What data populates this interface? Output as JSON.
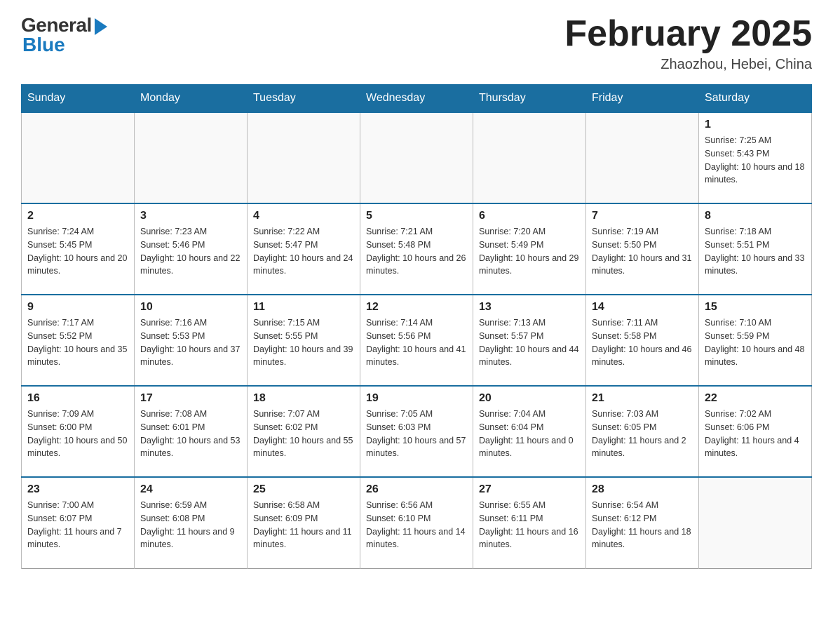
{
  "header": {
    "logo_general": "General",
    "logo_blue": "Blue",
    "month_title": "February 2025",
    "location": "Zhaozhou, Hebei, China"
  },
  "weekdays": [
    "Sunday",
    "Monday",
    "Tuesday",
    "Wednesday",
    "Thursday",
    "Friday",
    "Saturday"
  ],
  "weeks": [
    {
      "days": [
        {
          "num": "",
          "empty": true
        },
        {
          "num": "",
          "empty": true
        },
        {
          "num": "",
          "empty": true
        },
        {
          "num": "",
          "empty": true
        },
        {
          "num": "",
          "empty": true
        },
        {
          "num": "",
          "empty": true
        },
        {
          "num": "1",
          "sunrise": "7:25 AM",
          "sunset": "5:43 PM",
          "daylight": "10 hours and 18 minutes."
        }
      ]
    },
    {
      "days": [
        {
          "num": "2",
          "sunrise": "7:24 AM",
          "sunset": "5:45 PM",
          "daylight": "10 hours and 20 minutes."
        },
        {
          "num": "3",
          "sunrise": "7:23 AM",
          "sunset": "5:46 PM",
          "daylight": "10 hours and 22 minutes."
        },
        {
          "num": "4",
          "sunrise": "7:22 AM",
          "sunset": "5:47 PM",
          "daylight": "10 hours and 24 minutes."
        },
        {
          "num": "5",
          "sunrise": "7:21 AM",
          "sunset": "5:48 PM",
          "daylight": "10 hours and 26 minutes."
        },
        {
          "num": "6",
          "sunrise": "7:20 AM",
          "sunset": "5:49 PM",
          "daylight": "10 hours and 29 minutes."
        },
        {
          "num": "7",
          "sunrise": "7:19 AM",
          "sunset": "5:50 PM",
          "daylight": "10 hours and 31 minutes."
        },
        {
          "num": "8",
          "sunrise": "7:18 AM",
          "sunset": "5:51 PM",
          "daylight": "10 hours and 33 minutes."
        }
      ]
    },
    {
      "days": [
        {
          "num": "9",
          "sunrise": "7:17 AM",
          "sunset": "5:52 PM",
          "daylight": "10 hours and 35 minutes."
        },
        {
          "num": "10",
          "sunrise": "7:16 AM",
          "sunset": "5:53 PM",
          "daylight": "10 hours and 37 minutes."
        },
        {
          "num": "11",
          "sunrise": "7:15 AM",
          "sunset": "5:55 PM",
          "daylight": "10 hours and 39 minutes."
        },
        {
          "num": "12",
          "sunrise": "7:14 AM",
          "sunset": "5:56 PM",
          "daylight": "10 hours and 41 minutes."
        },
        {
          "num": "13",
          "sunrise": "7:13 AM",
          "sunset": "5:57 PM",
          "daylight": "10 hours and 44 minutes."
        },
        {
          "num": "14",
          "sunrise": "7:11 AM",
          "sunset": "5:58 PM",
          "daylight": "10 hours and 46 minutes."
        },
        {
          "num": "15",
          "sunrise": "7:10 AM",
          "sunset": "5:59 PM",
          "daylight": "10 hours and 48 minutes."
        }
      ]
    },
    {
      "days": [
        {
          "num": "16",
          "sunrise": "7:09 AM",
          "sunset": "6:00 PM",
          "daylight": "10 hours and 50 minutes."
        },
        {
          "num": "17",
          "sunrise": "7:08 AM",
          "sunset": "6:01 PM",
          "daylight": "10 hours and 53 minutes."
        },
        {
          "num": "18",
          "sunrise": "7:07 AM",
          "sunset": "6:02 PM",
          "daylight": "10 hours and 55 minutes."
        },
        {
          "num": "19",
          "sunrise": "7:05 AM",
          "sunset": "6:03 PM",
          "daylight": "10 hours and 57 minutes."
        },
        {
          "num": "20",
          "sunrise": "7:04 AM",
          "sunset": "6:04 PM",
          "daylight": "11 hours and 0 minutes."
        },
        {
          "num": "21",
          "sunrise": "7:03 AM",
          "sunset": "6:05 PM",
          "daylight": "11 hours and 2 minutes."
        },
        {
          "num": "22",
          "sunrise": "7:02 AM",
          "sunset": "6:06 PM",
          "daylight": "11 hours and 4 minutes."
        }
      ]
    },
    {
      "days": [
        {
          "num": "23",
          "sunrise": "7:00 AM",
          "sunset": "6:07 PM",
          "daylight": "11 hours and 7 minutes."
        },
        {
          "num": "24",
          "sunrise": "6:59 AM",
          "sunset": "6:08 PM",
          "daylight": "11 hours and 9 minutes."
        },
        {
          "num": "25",
          "sunrise": "6:58 AM",
          "sunset": "6:09 PM",
          "daylight": "11 hours and 11 minutes."
        },
        {
          "num": "26",
          "sunrise": "6:56 AM",
          "sunset": "6:10 PM",
          "daylight": "11 hours and 14 minutes."
        },
        {
          "num": "27",
          "sunrise": "6:55 AM",
          "sunset": "6:11 PM",
          "daylight": "11 hours and 16 minutes."
        },
        {
          "num": "28",
          "sunrise": "6:54 AM",
          "sunset": "6:12 PM",
          "daylight": "11 hours and 18 minutes."
        },
        {
          "num": "",
          "empty": true
        }
      ]
    }
  ]
}
